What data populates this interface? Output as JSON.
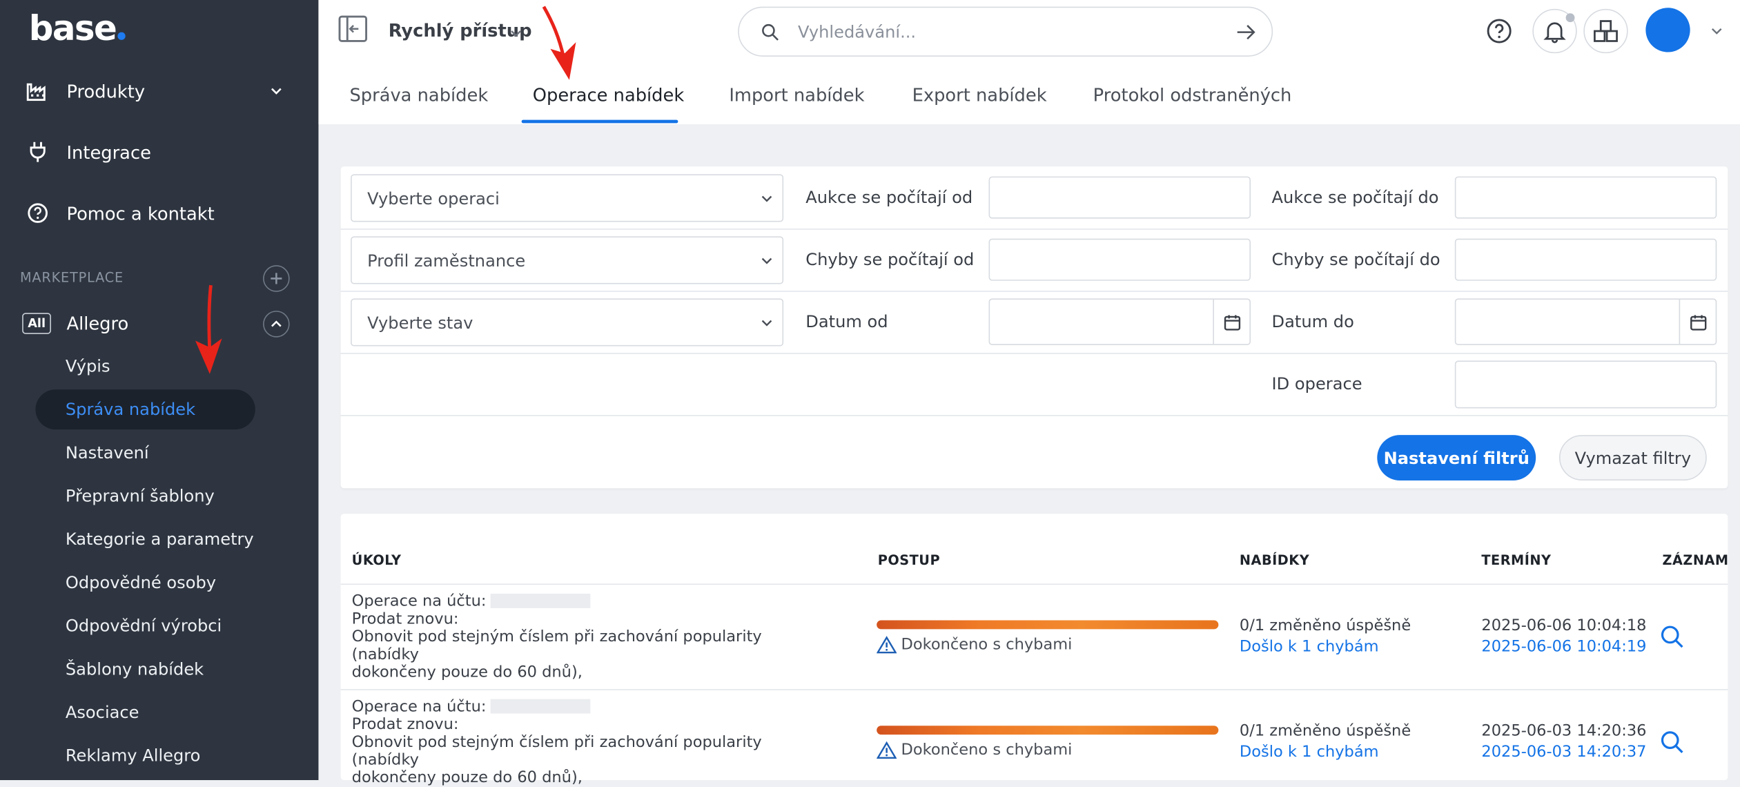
{
  "brand": {
    "logo": "base"
  },
  "sidebar": {
    "main": [
      {
        "label": "Produkty",
        "icon": "factory-icon"
      },
      {
        "label": "Integrace",
        "icon": "plug-icon"
      },
      {
        "label": "Pomoc a kontakt",
        "icon": "help-circle-icon"
      }
    ],
    "marketplace_label": "MARKETPLACE",
    "allegro": {
      "badge": "All",
      "label": "Allegro"
    },
    "sub_items": [
      {
        "label": "Výpis",
        "active": false
      },
      {
        "label": "Správa nabídek",
        "active": true
      },
      {
        "label": "Nastavení",
        "active": false
      },
      {
        "label": "Přepravní šablony",
        "active": false
      },
      {
        "label": "Kategorie a parametry",
        "active": false
      },
      {
        "label": "Odpovědné osoby",
        "active": false
      },
      {
        "label": "Odpovědní výrobci",
        "active": false
      },
      {
        "label": "Šablony nabídek",
        "active": false
      },
      {
        "label": "Asociace",
        "active": false
      },
      {
        "label": "Reklamy Allegro",
        "active": false
      }
    ]
  },
  "topbar": {
    "quick_access": "Rychlý přístup",
    "search_placeholder": "Vyhledávání..."
  },
  "tabs": [
    {
      "label": "Správa nabídek",
      "active": false
    },
    {
      "label": "Operace nabídek",
      "active": true
    },
    {
      "label": "Import nabídek",
      "active": false
    },
    {
      "label": "Export nabídek",
      "active": false
    },
    {
      "label": "Protokol odstraněných",
      "active": false
    }
  ],
  "filters": {
    "operation_select": "Vyberte operaci",
    "employee_select": "Profil zaměstnance",
    "state_select": "Vyberte stav",
    "auctions_from": "Aukce se počítají od",
    "auctions_to": "Aukce se počítají do",
    "errors_from": "Chyby se počítají od",
    "errors_to": "Chyby se počítají do",
    "date_from": "Datum od",
    "date_to": "Datum do",
    "operation_id": "ID operace",
    "apply_button": "Nastavení filtrů",
    "clear_button": "Vymazat filtry"
  },
  "table": {
    "headers": {
      "tasks": "ÚKOLY",
      "progress": "POSTUP",
      "offers": "NABÍDKY",
      "dates": "TERMÍNY",
      "record": "ZÁZNAM"
    },
    "rows": [
      {
        "account": "Operace na účtu:",
        "line2": "Prodat znovu:",
        "line3": "Obnovit pod stejným číslem při zachování popularity (nabídky",
        "line4": "dokončeny pouze do 60 dnů),",
        "progress": 1.0,
        "status": "Dokončeno s chybami",
        "offers_ok": "0/1 změněno úspěšně",
        "offers_err": "Došlo k 1 chybám",
        "date_start": "2025-06-06 10:04:18",
        "date_end": "2025-06-06 10:04:19"
      },
      {
        "account": "Operace na účtu:",
        "line2": "Prodat znovu:",
        "line3": "Obnovit pod stejným číslem při zachování popularity (nabídky",
        "line4": "dokončeny pouze do 60 dnů),",
        "progress": 1.0,
        "status": "Dokončeno s chybami",
        "offers_ok": "0/1 změněno úspěšně",
        "offers_err": "Došlo k 1 chybám",
        "date_start": "2025-06-03 14:20:36",
        "date_end": "2025-06-03 14:20:37"
      }
    ]
  },
  "colors": {
    "accent": "#1473e6",
    "sidebar": "#2e3540",
    "annotation": "#e8231a",
    "progress": "#ef7a27"
  }
}
